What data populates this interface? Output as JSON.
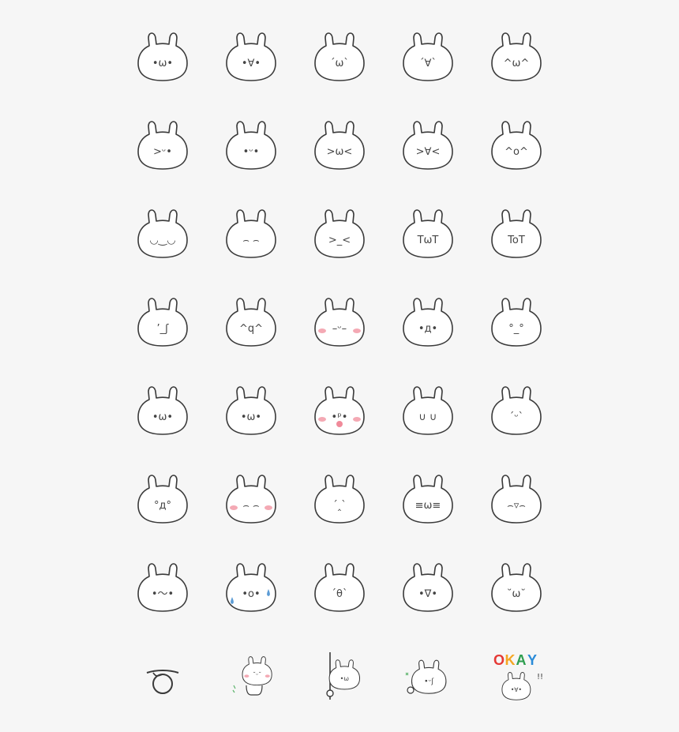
{
  "sheet": {
    "rows": [
      [
        {
          "name": "bunny-omega-dots",
          "face": "•ω•",
          "blush": false
        },
        {
          "name": "bunny-open-mouth",
          "face": "•∀•",
          "blush": false
        },
        {
          "name": "bunny-omega-brows",
          "face": "´ω`",
          "blush": false
        },
        {
          "name": "bunny-shout-brows",
          "face": "´∀`",
          "blush": false
        },
        {
          "name": "bunny-happy-omega",
          "face": "^ω^",
          "blush": false
        }
      ],
      [
        {
          "name": "bunny-wink-u",
          "face": ">ᵕ•",
          "blush": false
        },
        {
          "name": "bunny-smile-dots",
          "face": "•ᵕ•",
          "blush": false
        },
        {
          "name": "bunny-squint-omega",
          "face": ">ω<",
          "blush": false
        },
        {
          "name": "bunny-squint-shout",
          "face": ">∀<",
          "blush": false
        },
        {
          "name": "bunny-happy-o",
          "face": "^o^",
          "blush": false
        }
      ],
      [
        {
          "name": "bunny-content",
          "face": "◡‿◡",
          "blush": false
        },
        {
          "name": "bunny-closed-eyes",
          "face": "⌢ ⌢",
          "blush": false
        },
        {
          "name": "bunny-frustrated",
          "face": ">_<",
          "blush": false
        },
        {
          "name": "bunny-cry-omega",
          "face": "TωT",
          "blush": false
        },
        {
          "name": "bunny-cry-o",
          "face": "ToT",
          "blush": false
        }
      ],
      [
        {
          "name": "bunny-smirk",
          "face": "’_ʃ",
          "blush": false
        },
        {
          "name": "bunny-happy-q",
          "face": "^q^",
          "blush": false
        },
        {
          "name": "bunny-sleepy-blush",
          "face": "–ᵕ–",
          "blush": true
        },
        {
          "name": "bunny-shocked",
          "face": "•д•",
          "blush": false
        },
        {
          "name": "bunny-blank",
          "face": "°_°",
          "blush": false
        }
      ],
      [
        {
          "name": "bunny-smug-left",
          "face": "•ω•",
          "blush": false
        },
        {
          "name": "bunny-smug-right",
          "face": "•ω•",
          "blush": false
        },
        {
          "name": "bunny-tongue",
          "face": "•ᵖ•",
          "blush": true
        },
        {
          "name": "bunny-u-eyes",
          "face": "∪ ∪",
          "blush": false
        },
        {
          "name": "bunny-small-smile",
          "face": "´ᵕ`",
          "blush": false
        }
      ],
      [
        {
          "name": "bunny-surprised-d",
          "face": "°д°",
          "blush": false
        },
        {
          "name": "bunny-blush-closed",
          "face": "⌢ ⌢",
          "blush": true
        },
        {
          "name": "bunny-worried",
          "face": "´‸`",
          "blush": false
        },
        {
          "name": "bunny-cool",
          "face": "≡ω≡",
          "blush": false
        },
        {
          "name": "bunny-laughing",
          "face": "⌢▿⌢",
          "blush": false
        }
      ],
      [
        {
          "name": "bunny-wavy",
          "face": "•～•",
          "blush": false
        },
        {
          "name": "bunny-shocked-sweat",
          "face": "•o•",
          "blush": false
        },
        {
          "name": "bunny-theta",
          "face": "´θ`",
          "blush": false
        },
        {
          "name": "bunny-shout-small",
          "face": "•∇•",
          "blush": false
        },
        {
          "name": "bunny-peaceful",
          "face": "˘ω˘",
          "blush": false
        }
      ]
    ],
    "extras": [
      {
        "name": "rope-circle-sticker",
        "face": "",
        "blush": false
      },
      {
        "name": "bunny-body-sticker",
        "face": "˘ᵕ˘",
        "blush": true
      },
      {
        "name": "bunny-peek-sticker",
        "face": "•ω",
        "blush": false
      },
      {
        "name": "bunny-lying-sticker",
        "face": "•ᵕʃ",
        "blush": false
      },
      {
        "name": "okay-sticker",
        "face": "•∀•",
        "blush": false
      }
    ],
    "okay_text": "OKAY",
    "okay_exclaim": "!!",
    "colors": {
      "outline": "#3a3a3a",
      "face_fill": "#ffffff",
      "blush": "#f4a9b4",
      "tongue": "#f08a9a",
      "tear": "#5b9bd5",
      "okay_o": "#e53935",
      "okay_k": "#f5a623",
      "okay_a": "#2e9e4f",
      "okay_y": "#2a8bd8",
      "background": "#f6f6f6"
    }
  }
}
